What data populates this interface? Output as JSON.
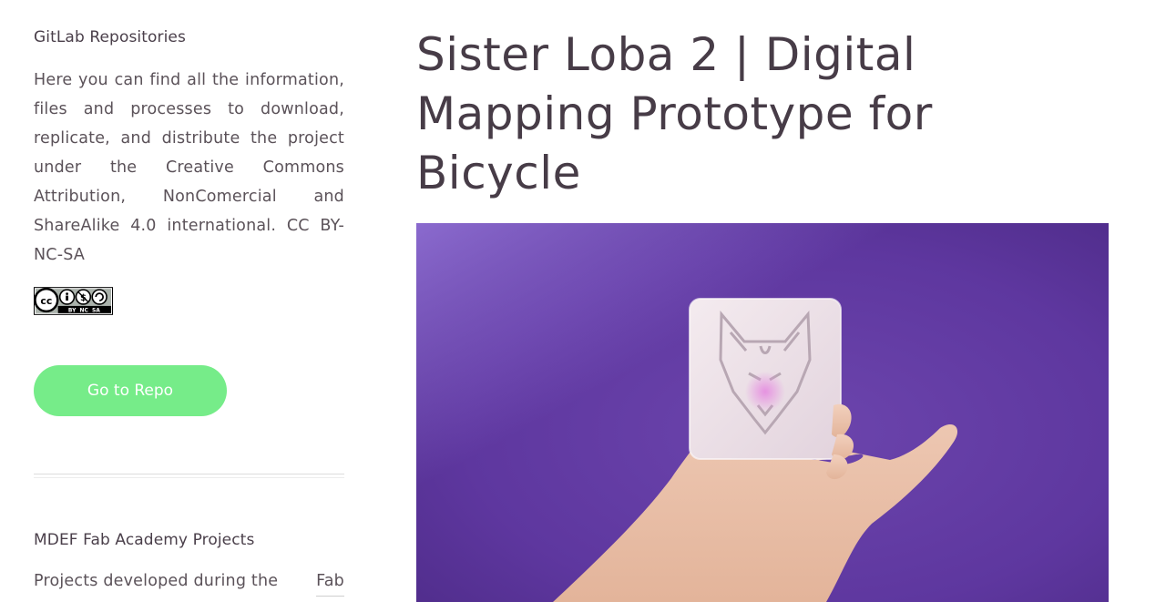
{
  "sidebar": {
    "section1": {
      "title": "GitLab Repositories",
      "paragraph": "Here you can find all the information, files and processes to download, replicate, and distribute the project under the Creative Commons Attribution, NonComercial and ShareAlike 4.0 international. CC BY-NC-SA",
      "license_badge": {
        "icon": "cc-by-nc-sa-badge-icon",
        "label": "BY  NC  SA"
      },
      "button_label": "Go to Repo"
    },
    "section2": {
      "title": "MDEF Fab Academy Projects",
      "paragraph_start": "Projects developed during the",
      "paragraph_link": "Fab"
    }
  },
  "main": {
    "title": "Sister Loba 2 | Digital Mapping Prototype for Bicycle",
    "hero_image": {
      "icon": "hand-holding-wolf-device-image"
    }
  },
  "colors": {
    "text": "#4a4047",
    "button": "#76ec89",
    "hero_background": "#6a3fa8"
  }
}
